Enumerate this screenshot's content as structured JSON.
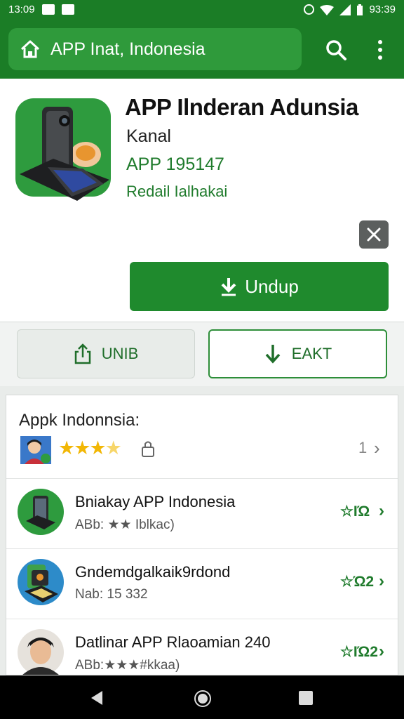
{
  "status_bar": {
    "time": "13:09",
    "right_time": "93:39"
  },
  "app_bar": {
    "title": "APP Inat, Indonesia"
  },
  "app": {
    "title": "APP Ilnderan Adunsia",
    "developer": "Kanal",
    "version": "APP 195147",
    "detail": "Redail Ialhakai"
  },
  "buttons": {
    "install": "Undup",
    "share": "UNIB",
    "exit": "EAKT"
  },
  "list": {
    "heading": "Appk Indonnsia:",
    "rating_count": "1",
    "items": [
      {
        "name": "Bniakay APP Indonesia",
        "sub": "ABb: ★★ Iblkac)",
        "rating": "☆ΙΏ"
      },
      {
        "name": "Gndemdgalkaik9rdond",
        "sub": "Nab: 15 332",
        "rating": "☆Ώ2"
      },
      {
        "name": "Datlinar APP Rlaoamian 240",
        "sub": "ABb:★★★#kkaa)",
        "rating": "☆ΙΏ2"
      }
    ]
  },
  "colors": {
    "primary": "#1b7d26",
    "accent": "#1f8a2d",
    "star": "#f2b705"
  },
  "icons": [
    "home-icon",
    "search-icon",
    "more-vert-icon",
    "close-icon",
    "download-icon",
    "share-icon",
    "lock-icon",
    "chevron-right-icon",
    "back-icon",
    "home-nav-icon",
    "recent-apps-icon"
  ]
}
